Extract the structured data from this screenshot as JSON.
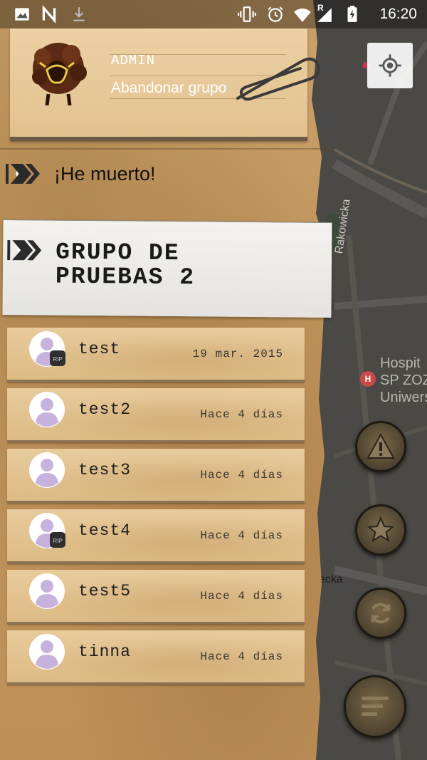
{
  "status_bar": {
    "time": "16:20",
    "icons": [
      "image-icon",
      "n-icon",
      "download-icon",
      "vibrate-icon",
      "alarm-icon",
      "wifi-icon",
      "signal-icon",
      "battery-icon"
    ],
    "roaming_label": "R"
  },
  "header": {
    "role": "ADMIN",
    "leave_group": "Abandonar grupo"
  },
  "dead_label": "¡He muerto!",
  "group": {
    "title": "GRUPO DE PRUEBAS 2"
  },
  "members": [
    {
      "name": "test",
      "date": "19 mar. 2015",
      "rip": true
    },
    {
      "name": "test2",
      "date": "Hace 4 días",
      "rip": false
    },
    {
      "name": "test3",
      "date": "Hace 4 días",
      "rip": false
    },
    {
      "name": "test4",
      "date": "Hace 4 días",
      "rip": true
    },
    {
      "name": "test5",
      "date": "Hace 4 días",
      "rip": false
    },
    {
      "name": "tinna",
      "date": "Hace 4 días",
      "rip": false
    }
  ],
  "rip_label": "RIP",
  "map": {
    "street_1": "Rakowicka",
    "hospital": "Hospit SP ZOZ Uniwers",
    "hospital_lines": [
      "Hospit",
      "SP ZOZ",
      "Uniwers"
    ],
    "hospital_pin": "H",
    "street_2": "zecka"
  },
  "colors": {
    "paper": "#c3975e",
    "card": "#e2c18e",
    "map": "#4a4945",
    "avatar": "#c7b2dd",
    "fab": "#4e4330"
  }
}
